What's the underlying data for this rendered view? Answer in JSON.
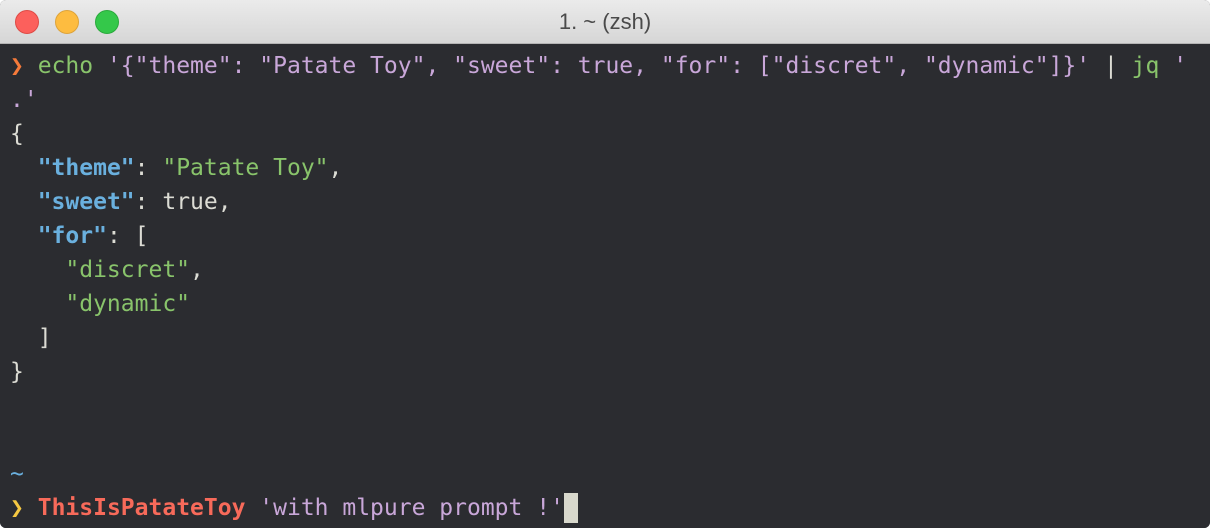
{
  "window": {
    "title": "1. ~ (zsh)"
  },
  "command": {
    "prompt_symbol": "❯",
    "cmd": "echo",
    "arg_line1": " '{\"theme\": \"Patate Toy\", \"sweet\": true, \"for\": [\"discret\", \"dynamic\"]}'",
    "pipe": " | ",
    "jq": "jq",
    "jq_arg_start": " '",
    "jq_arg_end": ".'"
  },
  "output": {
    "open_brace": "{",
    "theme_key": "\"theme\"",
    "theme_sep": ": ",
    "theme_val": "\"Patate Toy\"",
    "theme_comma": ",",
    "sweet_key": "\"sweet\"",
    "sweet_sep": ": ",
    "sweet_val": "true,",
    "for_key": "\"for\"",
    "for_sep": ": [",
    "item1": "\"discret\"",
    "item1_comma": ",",
    "item2": "\"dynamic\"",
    "close_bracket": "]",
    "close_brace": "}"
  },
  "prompt2": {
    "cwd": "~",
    "prompt_symbol": "❯",
    "command": "ThisIsPatateToy",
    "arg": " 'with mlpure prompt !'"
  },
  "colors": {
    "background": "#2b2c30",
    "key": "#6ab0de",
    "string": "#89c46b",
    "purple": "#c9a7d9",
    "orange": "#f57a3a",
    "yellow": "#f5c842",
    "red": "#f76a5a"
  }
}
